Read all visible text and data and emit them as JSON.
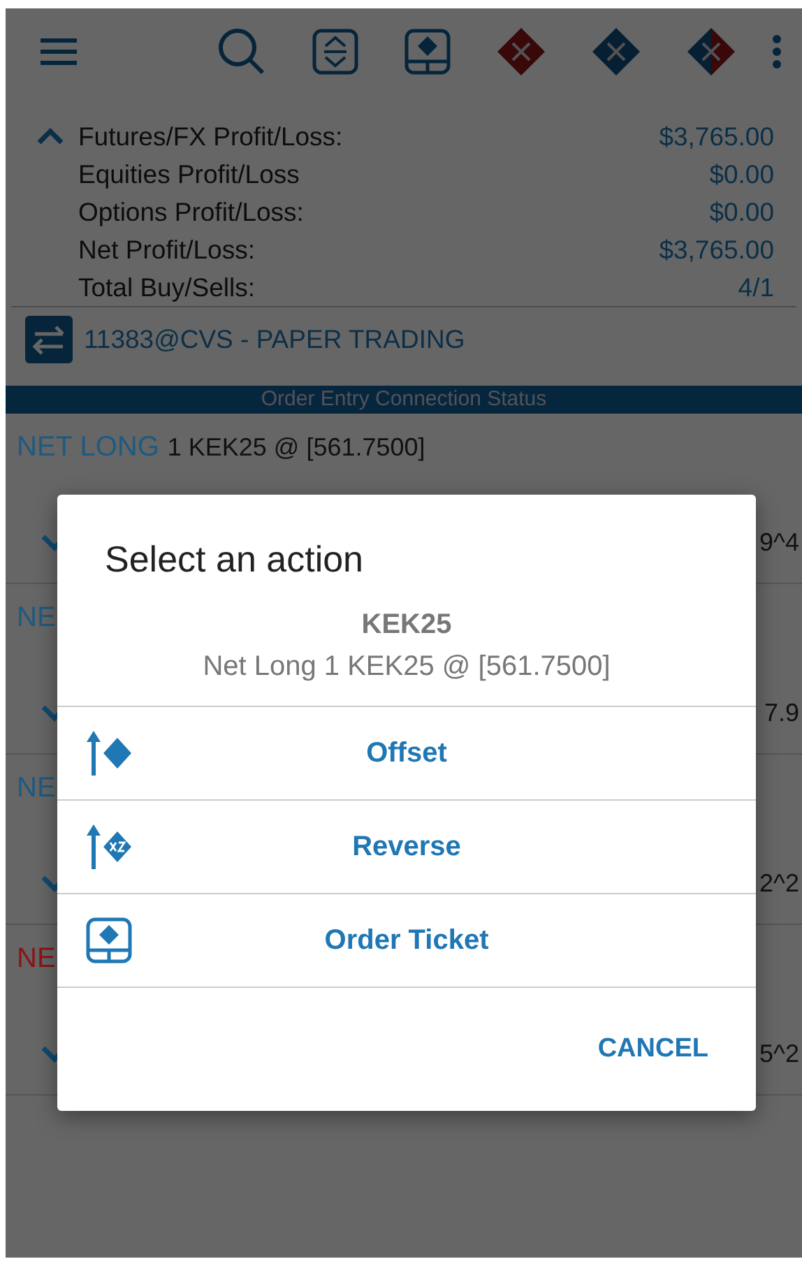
{
  "summary": {
    "expanded": true,
    "rows": [
      {
        "label": "Futures/FX Profit/Loss:",
        "value": "$3,765.00"
      },
      {
        "label": "Equities Profit/Loss",
        "value": "$0.00"
      },
      {
        "label": "Options Profit/Loss:",
        "value": "$0.00"
      },
      {
        "label": "Net Profit/Loss:",
        "value": "$3,765.00"
      },
      {
        "label": "Total Buy/Sells:",
        "value": "4/1"
      }
    ]
  },
  "account": {
    "name": "11383@CVS - PAPER TRADING"
  },
  "status_bar": "Order Entry Connection Status",
  "positions": [
    {
      "side": "NET LONG",
      "detail": "1 KEK25 @ [561.7500]",
      "value": "9^4",
      "color": "#1d5a82",
      "expanded": false
    },
    {
      "side": "NE",
      "value": "7.9",
      "color": "#1d5a82",
      "expanded": false
    },
    {
      "side": "NE",
      "value": "2^2",
      "color": "#1d5a82",
      "expanded": false
    },
    {
      "side": "NE",
      "value": "5^2",
      "color": "#8c1414",
      "expanded": false
    }
  ],
  "dialog": {
    "title": "Select an action",
    "symbol": "KEK25",
    "subtitle": "Net Long 1 KEK25 @ [561.7500]",
    "actions": [
      {
        "kind": "offset",
        "label": "Offset"
      },
      {
        "kind": "reverse",
        "label": "Reverse"
      },
      {
        "kind": "ticket",
        "label": "Order Ticket"
      }
    ],
    "cancel": "CANCEL"
  }
}
